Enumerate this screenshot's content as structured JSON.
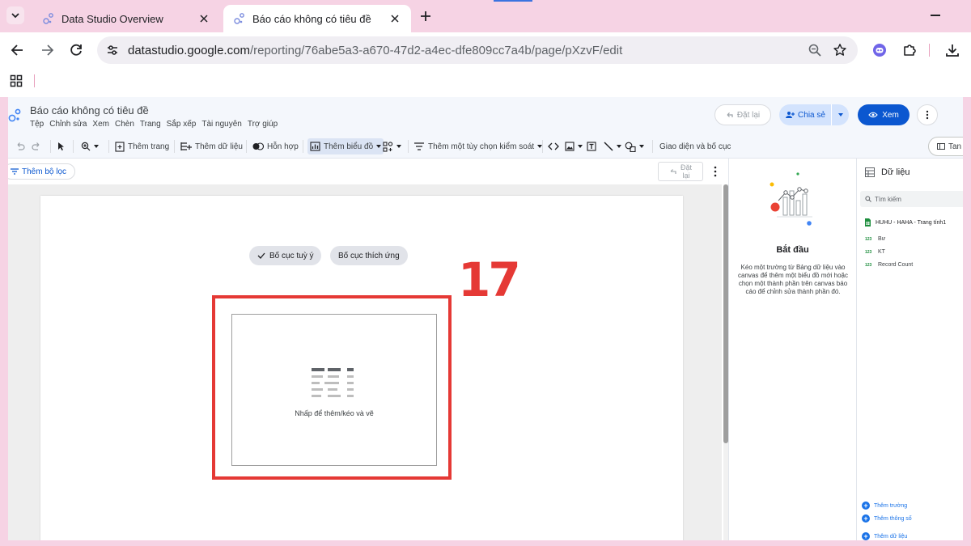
{
  "browser": {
    "tabs": [
      {
        "label": "Data Studio Overview",
        "active": false
      },
      {
        "label": "Báo cáo không có tiêu đề",
        "active": true
      }
    ],
    "url_domain": "datastudio.google.com",
    "url_path": "/reporting/76abe5a3-a670-47d2-a4ec-dfe809cc7a4b/page/pXzvF/edit"
  },
  "app": {
    "title": "Báo cáo không có tiêu đề",
    "menu": [
      "Tệp",
      "Chỉnh sửa",
      "Xem",
      "Chèn",
      "Trang",
      "Sắp xếp",
      "Tài nguyên",
      "Trợ giúp"
    ],
    "reset_label": "Đặt lại",
    "share_label": "Chia sẻ",
    "view_label": "Xem"
  },
  "toolbar": {
    "add_page": "Thêm trang",
    "add_data": "Thêm dữ liệu",
    "blend": "Hỗn hợp",
    "add_chart": "Thêm biểu đồ",
    "add_control": "Thêm một tùy chọn kiểm soát",
    "theme_layout": "Giao diện và bố cục",
    "theme_button": "Tan"
  },
  "filter": {
    "add_filter": "Thêm bộ lọc",
    "reset_line1": "Đặt",
    "reset_line2": "lại"
  },
  "canvas": {
    "layout_free": "Bố cục tuỳ ý",
    "layout_responsive": "Bố cục thích ứng",
    "placeholder_text": "Nhấp để thêm/kéo và vẽ"
  },
  "annotation": {
    "number": "17",
    "color": "#e53935"
  },
  "start_panel": {
    "title": "Bắt đầu",
    "description": "Kéo một trường từ Bảng dữ liệu vào canvas để thêm một biểu đồ mới hoặc chọn một thành phần trên canvas báo cáo để chỉnh sửa thành phần đó."
  },
  "data_panel": {
    "title": "Dữ liệu",
    "search_placeholder": "Tìm kiếm",
    "source": "HUHU - HAHA - Trang tính1",
    "fields": [
      {
        "type": "123",
        "name": "Bư"
      },
      {
        "type": "123",
        "name": "KT"
      },
      {
        "type": "123",
        "name": "Record Count"
      }
    ],
    "actions": [
      "Thêm trường",
      "Thêm thông số",
      "Thêm dữ liệu"
    ]
  },
  "colors": {
    "frame": "#f6d3e4",
    "primary_blue": "#0b57d0",
    "share_bg": "#d3e3fd",
    "sheets_green": "#1e8e3e"
  }
}
